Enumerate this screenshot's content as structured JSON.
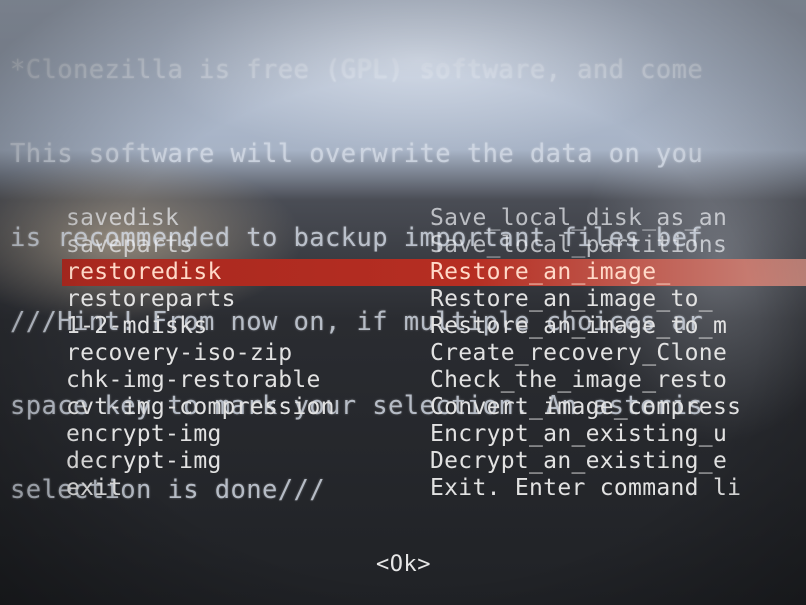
{
  "intro_lines": [
    "*Clonezilla is free (GPL) software, and come",
    "This software will overwrite the data on you",
    "is recommended to backup important files bef",
    "///Hint! From now on, if multiple choices ar",
    "space key to mark your selection. An asteris",
    "selection is done///"
  ],
  "menu": {
    "items": [
      {
        "key": "savedisk",
        "desc": "Save_local_disk_as_an"
      },
      {
        "key": "saveparts",
        "desc": "Save_local_partitions"
      },
      {
        "key": "restoredisk",
        "desc": "Restore_an_image_"
      },
      {
        "key": "restoreparts",
        "desc": "Restore_an_image_to_"
      },
      {
        "key": "1-2-mdisks",
        "desc": "Restore_an_image_to_m"
      },
      {
        "key": "recovery-iso-zip",
        "desc": "Create_recovery_Clone"
      },
      {
        "key": "chk-img-restorable",
        "desc": "Check_the_image_resto"
      },
      {
        "key": "cvt-img-compression",
        "desc": "Convert_image_compress"
      },
      {
        "key": "encrypt-img",
        "desc": "Encrypt_an_existing_u"
      },
      {
        "key": "decrypt-img",
        "desc": "Decrypt_an_existing_e"
      },
      {
        "key": "exit",
        "desc": "Exit. Enter command li"
      }
    ],
    "selected_key": "restoredisk"
  },
  "ok_button": "<Ok>",
  "colors": {
    "selection_bar": "#b62e22",
    "menu_text": "#e2e2e2",
    "background": "#202226"
  }
}
